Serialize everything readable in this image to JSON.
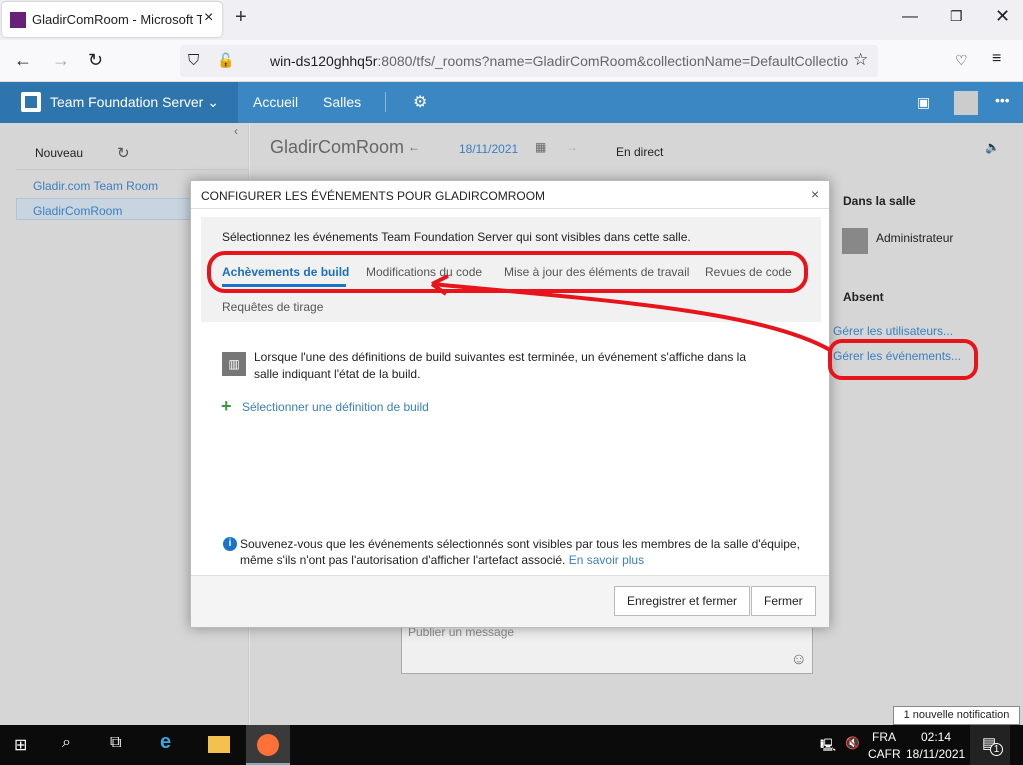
{
  "browser": {
    "tab_title": "GladirComRoom - Microsoft Te",
    "url_host": "win-ds120ghhq5r",
    "url_rest": ":8080/tfs/_rooms?name=GladirComRoom&collectionName=DefaultCollectio"
  },
  "tfs": {
    "brand": "Team Foundation Server",
    "nav": [
      "Accueil",
      "Salles"
    ]
  },
  "sidebar": {
    "new_label": "Nouveau",
    "rooms": [
      "Gladir.com Team Room",
      "GladirComRoom"
    ]
  },
  "room": {
    "title": "GladirComRoom",
    "date": "18/11/2021",
    "live": "En direct",
    "message_placeholder": "Publier un message"
  },
  "right": {
    "in_room": "Dans la salle",
    "user": "Administrateur",
    "absent": "Absent",
    "manage_users": "Gérer les utilisateurs...",
    "manage_events": "Gérer les événements..."
  },
  "modal": {
    "title": "CONFIGURER LES ÉVÉNEMENTS POUR GLADIRCOMROOM",
    "close": "×",
    "intro": "Sélectionnez les événements Team Foundation Server qui sont visibles dans cette salle.",
    "tabs": [
      "Achèvements de build",
      "Modifications du code",
      "Mise à jour des éléments de travail",
      "Revues de code",
      "Requêtes de tirage"
    ],
    "description": "Lorsque l'une des définitions de build suivantes est terminée, un événement s'affiche dans la salle indiquant l'état de la build.",
    "add_link": "Sélectionner une définition de build",
    "note": "Souvenez-vous que les événements sélectionnés sont visibles par tous les membres de la salle d'équipe, même s'ils n'ont pas l'autorisation d'afficher l'artefact associé.",
    "learn_more": "En savoir plus",
    "save": "Enregistrer et fermer",
    "cancel": "Fermer"
  },
  "taskbar": {
    "lang1": "FRA",
    "lang2": "CAFR",
    "time": "02:14",
    "date": "18/11/2021",
    "notif_count": "1",
    "toast": "1 nouvelle notification"
  }
}
